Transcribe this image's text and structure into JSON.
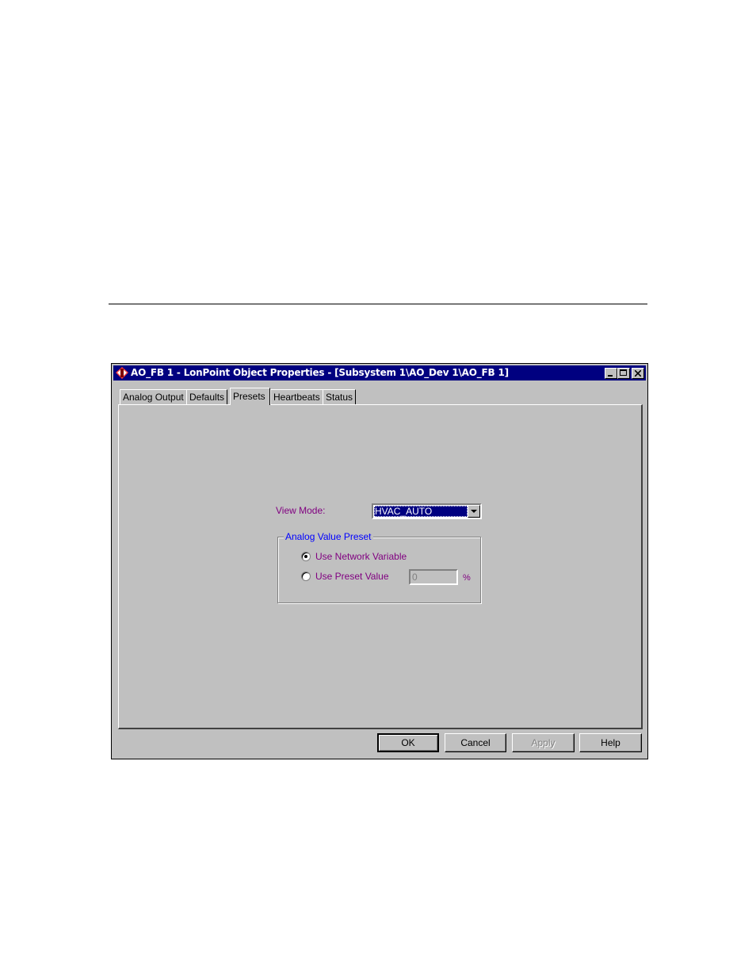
{
  "window": {
    "title": "AO_FB 1 - LonPoint Object Properties - [Subsystem 1\\AO_Dev 1\\AO_FB 1]"
  },
  "tabs": [
    {
      "label": "Analog Output"
    },
    {
      "label": "Defaults"
    },
    {
      "label": "Presets"
    },
    {
      "label": "Heartbeats"
    },
    {
      "label": "Status"
    }
  ],
  "active_tab": "Presets",
  "presets": {
    "view_mode_label": "View Mode:",
    "view_mode_value": "HVAC_AUTO",
    "group_title": "Analog Value Preset",
    "radio_network_label": "Use Network Variable",
    "radio_preset_label": "Use Preset Value",
    "selected_option": "Use Network Variable",
    "preset_value": "0",
    "unit": "%"
  },
  "buttons": {
    "ok": "OK",
    "cancel": "Cancel",
    "apply": "Apply",
    "help": "Help"
  },
  "colors": {
    "titlebar": "#000080",
    "label_purple": "#800080",
    "group_title_blue": "#0000ff",
    "face": "#c0c0c0"
  }
}
